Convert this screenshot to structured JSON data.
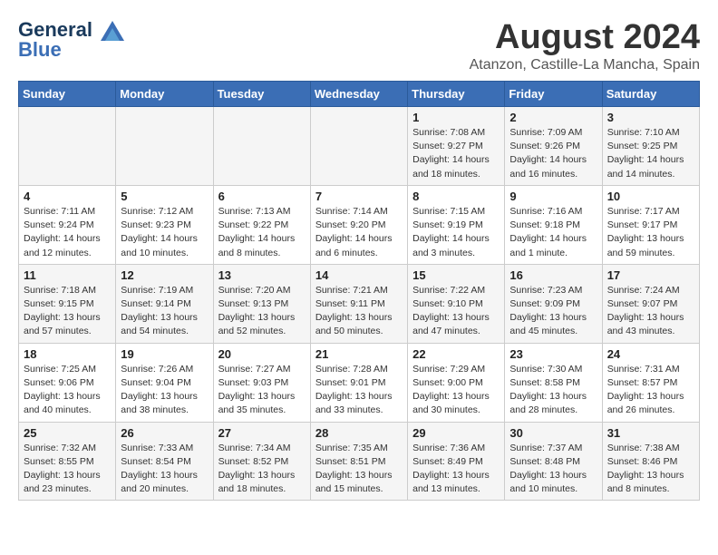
{
  "header": {
    "logo_line1": "General",
    "logo_line2": "Blue",
    "month_title": "August 2024",
    "location": "Atanzon, Castille-La Mancha, Spain"
  },
  "weekdays": [
    "Sunday",
    "Monday",
    "Tuesday",
    "Wednesday",
    "Thursday",
    "Friday",
    "Saturday"
  ],
  "weeks": [
    [
      {
        "day": "",
        "info": ""
      },
      {
        "day": "",
        "info": ""
      },
      {
        "day": "",
        "info": ""
      },
      {
        "day": "",
        "info": ""
      },
      {
        "day": "1",
        "info": "Sunrise: 7:08 AM\nSunset: 9:27 PM\nDaylight: 14 hours\nand 18 minutes."
      },
      {
        "day": "2",
        "info": "Sunrise: 7:09 AM\nSunset: 9:26 PM\nDaylight: 14 hours\nand 16 minutes."
      },
      {
        "day": "3",
        "info": "Sunrise: 7:10 AM\nSunset: 9:25 PM\nDaylight: 14 hours\nand 14 minutes."
      }
    ],
    [
      {
        "day": "4",
        "info": "Sunrise: 7:11 AM\nSunset: 9:24 PM\nDaylight: 14 hours\nand 12 minutes."
      },
      {
        "day": "5",
        "info": "Sunrise: 7:12 AM\nSunset: 9:23 PM\nDaylight: 14 hours\nand 10 minutes."
      },
      {
        "day": "6",
        "info": "Sunrise: 7:13 AM\nSunset: 9:22 PM\nDaylight: 14 hours\nand 8 minutes."
      },
      {
        "day": "7",
        "info": "Sunrise: 7:14 AM\nSunset: 9:20 PM\nDaylight: 14 hours\nand 6 minutes."
      },
      {
        "day": "8",
        "info": "Sunrise: 7:15 AM\nSunset: 9:19 PM\nDaylight: 14 hours\nand 3 minutes."
      },
      {
        "day": "9",
        "info": "Sunrise: 7:16 AM\nSunset: 9:18 PM\nDaylight: 14 hours\nand 1 minute."
      },
      {
        "day": "10",
        "info": "Sunrise: 7:17 AM\nSunset: 9:17 PM\nDaylight: 13 hours\nand 59 minutes."
      }
    ],
    [
      {
        "day": "11",
        "info": "Sunrise: 7:18 AM\nSunset: 9:15 PM\nDaylight: 13 hours\nand 57 minutes."
      },
      {
        "day": "12",
        "info": "Sunrise: 7:19 AM\nSunset: 9:14 PM\nDaylight: 13 hours\nand 54 minutes."
      },
      {
        "day": "13",
        "info": "Sunrise: 7:20 AM\nSunset: 9:13 PM\nDaylight: 13 hours\nand 52 minutes."
      },
      {
        "day": "14",
        "info": "Sunrise: 7:21 AM\nSunset: 9:11 PM\nDaylight: 13 hours\nand 50 minutes."
      },
      {
        "day": "15",
        "info": "Sunrise: 7:22 AM\nSunset: 9:10 PM\nDaylight: 13 hours\nand 47 minutes."
      },
      {
        "day": "16",
        "info": "Sunrise: 7:23 AM\nSunset: 9:09 PM\nDaylight: 13 hours\nand 45 minutes."
      },
      {
        "day": "17",
        "info": "Sunrise: 7:24 AM\nSunset: 9:07 PM\nDaylight: 13 hours\nand 43 minutes."
      }
    ],
    [
      {
        "day": "18",
        "info": "Sunrise: 7:25 AM\nSunset: 9:06 PM\nDaylight: 13 hours\nand 40 minutes."
      },
      {
        "day": "19",
        "info": "Sunrise: 7:26 AM\nSunset: 9:04 PM\nDaylight: 13 hours\nand 38 minutes."
      },
      {
        "day": "20",
        "info": "Sunrise: 7:27 AM\nSunset: 9:03 PM\nDaylight: 13 hours\nand 35 minutes."
      },
      {
        "day": "21",
        "info": "Sunrise: 7:28 AM\nSunset: 9:01 PM\nDaylight: 13 hours\nand 33 minutes."
      },
      {
        "day": "22",
        "info": "Sunrise: 7:29 AM\nSunset: 9:00 PM\nDaylight: 13 hours\nand 30 minutes."
      },
      {
        "day": "23",
        "info": "Sunrise: 7:30 AM\nSunset: 8:58 PM\nDaylight: 13 hours\nand 28 minutes."
      },
      {
        "day": "24",
        "info": "Sunrise: 7:31 AM\nSunset: 8:57 PM\nDaylight: 13 hours\nand 26 minutes."
      }
    ],
    [
      {
        "day": "25",
        "info": "Sunrise: 7:32 AM\nSunset: 8:55 PM\nDaylight: 13 hours\nand 23 minutes."
      },
      {
        "day": "26",
        "info": "Sunrise: 7:33 AM\nSunset: 8:54 PM\nDaylight: 13 hours\nand 20 minutes."
      },
      {
        "day": "27",
        "info": "Sunrise: 7:34 AM\nSunset: 8:52 PM\nDaylight: 13 hours\nand 18 minutes."
      },
      {
        "day": "28",
        "info": "Sunrise: 7:35 AM\nSunset: 8:51 PM\nDaylight: 13 hours\nand 15 minutes."
      },
      {
        "day": "29",
        "info": "Sunrise: 7:36 AM\nSunset: 8:49 PM\nDaylight: 13 hours\nand 13 minutes."
      },
      {
        "day": "30",
        "info": "Sunrise: 7:37 AM\nSunset: 8:48 PM\nDaylight: 13 hours\nand 10 minutes."
      },
      {
        "day": "31",
        "info": "Sunrise: 7:38 AM\nSunset: 8:46 PM\nDaylight: 13 hours\nand 8 minutes."
      }
    ]
  ]
}
